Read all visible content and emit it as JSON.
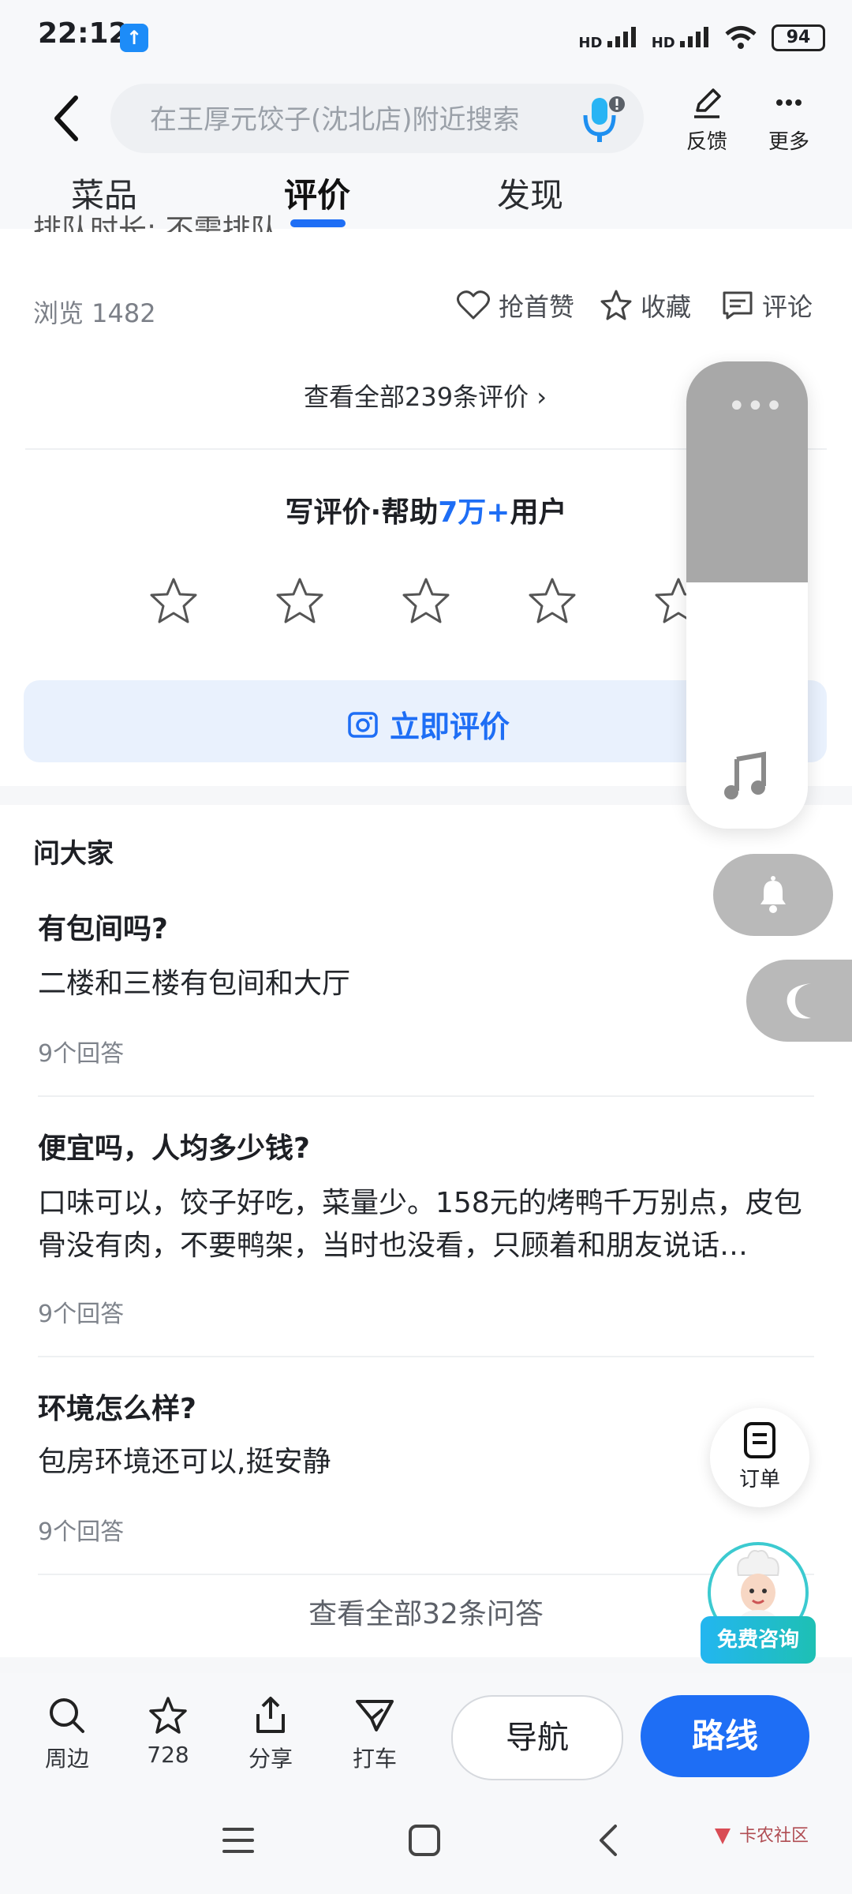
{
  "status": {
    "time": "22:12",
    "network1": "HD",
    "network2": "HD",
    "battery": "94"
  },
  "header": {
    "search_placeholder": "在王厚元饺子(沈北店)附近搜索",
    "feedback_label": "反馈",
    "more_label": "更多"
  },
  "tabs": [
    {
      "label": "菜品"
    },
    {
      "label": "评价"
    },
    {
      "label": "发现"
    }
  ],
  "review_section": {
    "partial_text": "排队时长: 不需排队",
    "views": "浏览 1482",
    "actions": [
      {
        "label": "抢首赞",
        "icon": "heart-icon"
      },
      {
        "label": "收藏",
        "icon": "star-outline-icon"
      },
      {
        "label": "评论",
        "icon": "comment-icon"
      }
    ],
    "see_all": "查看全部239条评价",
    "write_prefix": "写评价·帮助",
    "write_accent": "7万+",
    "write_suffix": "用户",
    "rate_button": "立即评价"
  },
  "qa": {
    "title": "问大家",
    "items": [
      {
        "question": "有包间吗?",
        "answer": "二楼和三楼有包间和大厅",
        "count": "9个回答"
      },
      {
        "question": "便宜吗，人均多少钱?",
        "answer": "口味可以，饺子好吃，菜量少。158元的烤鸭千万别点，皮包骨没有肉，不要鸭架，当时也没看，只顾着和朋友说话…",
        "count": "9个回答"
      },
      {
        "question": "环境怎么样?",
        "answer": "包房环境还可以,挺安静",
        "count": "9个回答"
      }
    ],
    "see_all": "查看全部32条问答"
  },
  "floating": {
    "order_label": "订单",
    "consult_label": "免费咨询"
  },
  "bottom_nav": {
    "items": [
      {
        "label": "周边",
        "icon": "search-icon"
      },
      {
        "label": "728",
        "icon": "star-outline-icon"
      },
      {
        "label": "分享",
        "icon": "share-icon"
      },
      {
        "label": "打车",
        "icon": "taxi-icon"
      }
    ],
    "navigate_label": "导航",
    "route_label": "路线"
  },
  "watermark": {
    "text": "卡农社区"
  },
  "colors": {
    "accent": "#1e6ef5",
    "background": "#f6f7f9"
  }
}
